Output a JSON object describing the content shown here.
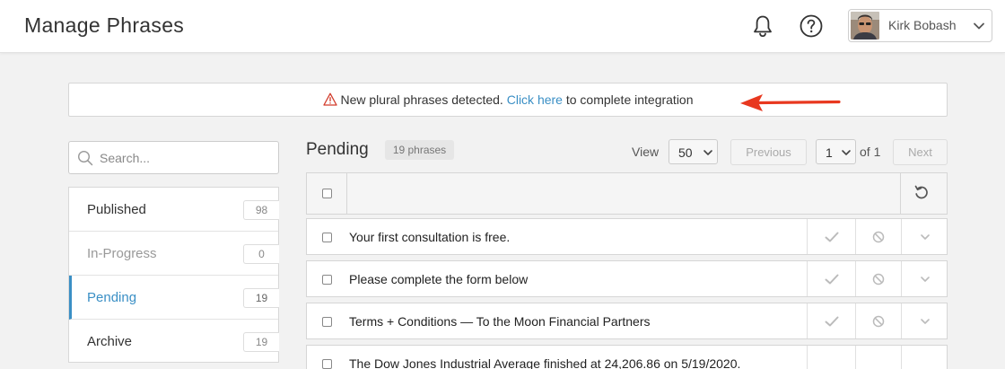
{
  "header": {
    "title": "Manage Phrases",
    "user_name": "Kirk Bobash",
    "icons": [
      "bell-icon",
      "help-icon",
      "chevron-down-icon"
    ]
  },
  "alert": {
    "icon": "warning-icon",
    "text_before": "New plural phrases detected.",
    "link_text": "Click here",
    "text_after": "to complete integration"
  },
  "sidebar": {
    "search_placeholder": "Search...",
    "items": [
      {
        "label": "Published",
        "count": "98"
      },
      {
        "label": "In-Progress",
        "count": "0"
      },
      {
        "label": "Pending",
        "count": "19"
      },
      {
        "label": "Archive",
        "count": "19"
      }
    ],
    "active": "Pending"
  },
  "main": {
    "title": "Pending",
    "badge": "19 phrases",
    "view_label": "View",
    "page_size": "50",
    "prev_label": "Previous",
    "page": "1",
    "of_label": "of 1",
    "next_label": "Next"
  },
  "rows": [
    {
      "text": "Your first consultation is free."
    },
    {
      "text": "Please complete the form below"
    },
    {
      "text": "Terms + Conditions — To the Moon Financial Partners"
    },
    {
      "text": "The Dow Jones Industrial Average finished at 24,206.86 on 5/19/2020."
    }
  ],
  "colors": {
    "accent": "#3a8fc5",
    "arrow": "#e8381f",
    "warning": "#d23b2b"
  }
}
